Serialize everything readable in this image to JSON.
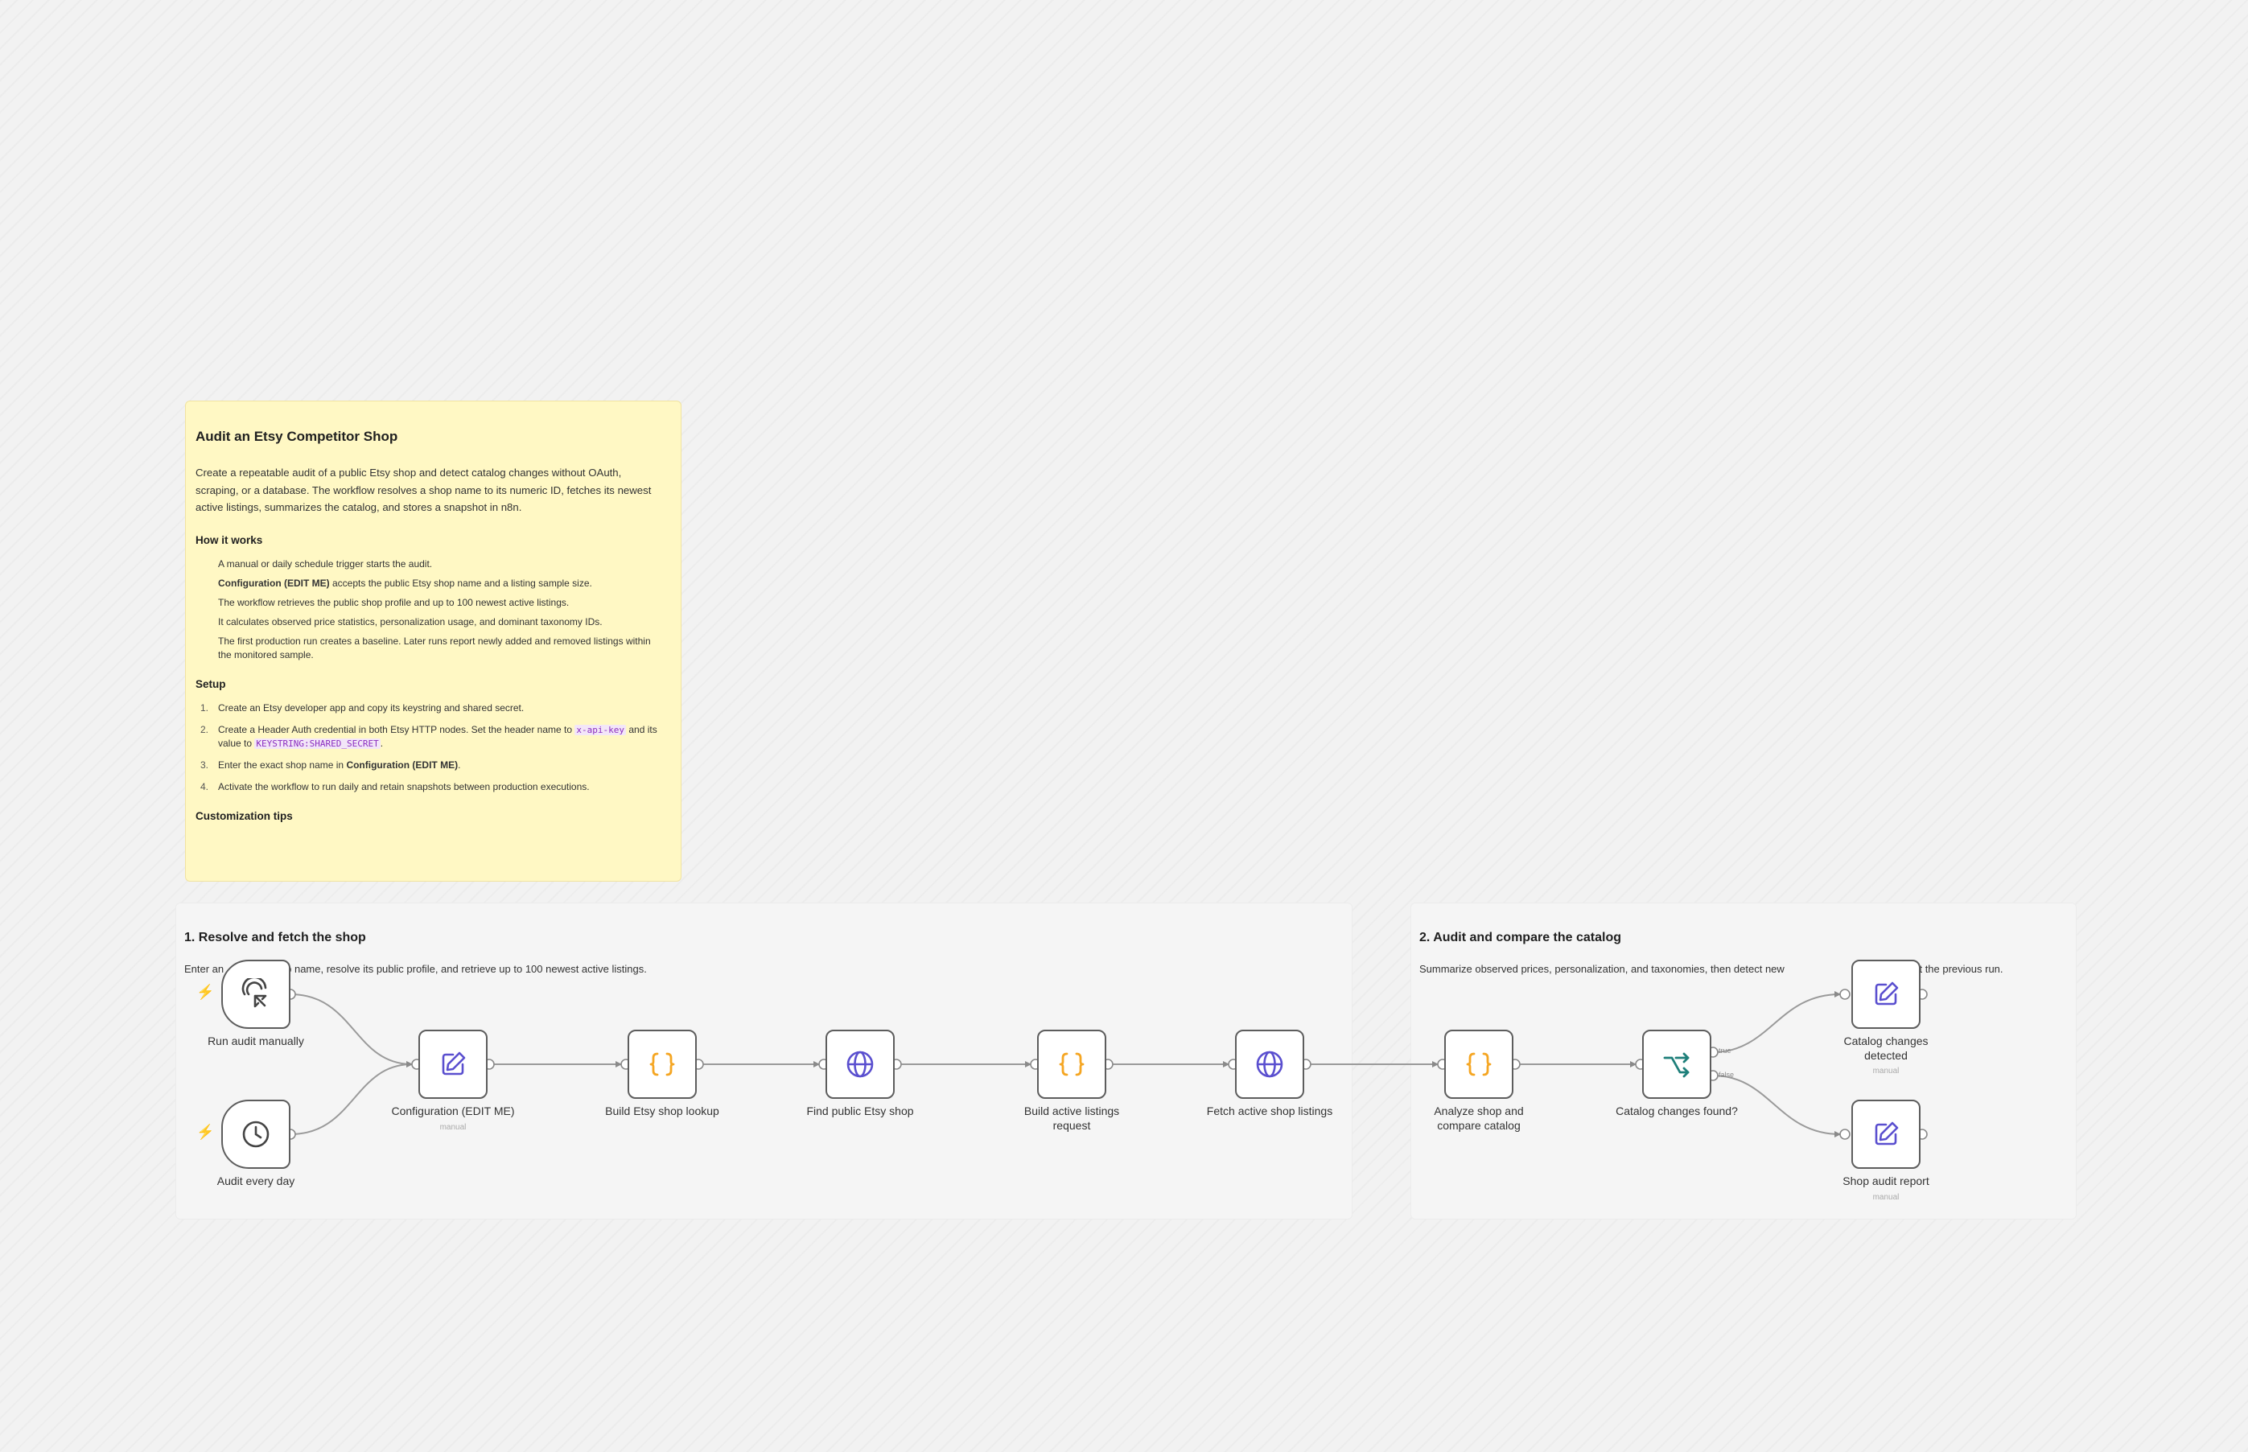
{
  "note": {
    "title": "Audit an Etsy Competitor Shop",
    "intro": "Create a repeatable audit of a public Etsy shop and detect catalog changes without OAuth, scraping, or a database. The workflow resolves a shop name to its numeric ID, fetches its newest active listings, summarizes the catalog, and stores a snapshot in n8n.",
    "how_title": "How it works",
    "how": [
      "A manual or daily schedule trigger starts the audit.",
      "accepts the public Etsy shop name and a listing sample size.",
      "The workflow retrieves the public shop profile and up to 100 newest active listings.",
      "It calculates observed price statistics, personalization usage, and dominant taxonomy IDs.",
      "The first production run creates a baseline. Later runs report newly added and removed listings within the monitored sample."
    ],
    "how_bold_2": "Configuration (EDIT ME)",
    "setup_title": "Setup",
    "setup_1": "Create an Etsy developer app and copy its keystring and shared secret.",
    "setup_2a": "Create a Header Auth credential in both Etsy HTTP nodes. Set the header name to",
    "setup_2_code1": "x-api-key",
    "setup_2b": "and its value to",
    "setup_2_code2": "KEYSTRING:SHARED_SECRET",
    "setup_2c": ".",
    "setup_3a": "Enter the exact shop name in",
    "setup_3_bold": "Configuration (EDIT ME)",
    "setup_3b": ".",
    "setup_4": "Activate the workflow to run daily and retain snapshots between production executions.",
    "nums": [
      "1.",
      "2.",
      "3.",
      "4."
    ],
    "custom_title": "Customization tips"
  },
  "groups": [
    {
      "title": "1. Resolve and fetch the shop",
      "desc_a": "Enter an",
      "desc_b": "shop name, resolve its public profile, and retrieve up to 100 newest active listings."
    },
    {
      "title": "2. Audit and compare the catalog",
      "desc_a": "Summarize observed prices, personalization, and taxonomies, then detect new",
      "desc_b": "listings against the previous run."
    }
  ],
  "nodes": {
    "run_manual": {
      "label": "Run audit manually",
      "icon": "cursor-click-icon"
    },
    "audit_daily": {
      "label": "Audit every day",
      "icon": "clock-icon"
    },
    "config": {
      "label": "Configuration (EDIT ME)",
      "sub": "manual",
      "icon": "edit-icon"
    },
    "build_lookup": {
      "label": "Build Etsy shop lookup",
      "icon": "code-braces-icon"
    },
    "find_shop": {
      "label": "Find public Etsy shop",
      "icon": "globe-icon"
    },
    "build_listings": {
      "label": "Build active listings request",
      "icon": "code-braces-icon"
    },
    "fetch_listings": {
      "label": "Fetch active shop listings",
      "icon": "globe-icon"
    },
    "analyze": {
      "label": "Analyze shop and compare catalog",
      "icon": "code-braces-icon"
    },
    "changes_found": {
      "label": "Catalog changes found?",
      "icon": "split-icon",
      "true_label": "true",
      "false_label": "false"
    },
    "changes_detected": {
      "label": "Catalog changes detected",
      "sub": "manual",
      "icon": "edit-icon"
    },
    "shop_report": {
      "label": "Shop audit report",
      "sub": "manual",
      "icon": "edit-icon"
    }
  },
  "colors": {
    "node_border": "#5d5d5d",
    "icon_purple": "#5a4fcf",
    "icon_orange": "#f5a623",
    "icon_teal": "#1e7f7a",
    "trigger_bolt": "#ff6d2b",
    "note_bg": "#fff8c4"
  }
}
